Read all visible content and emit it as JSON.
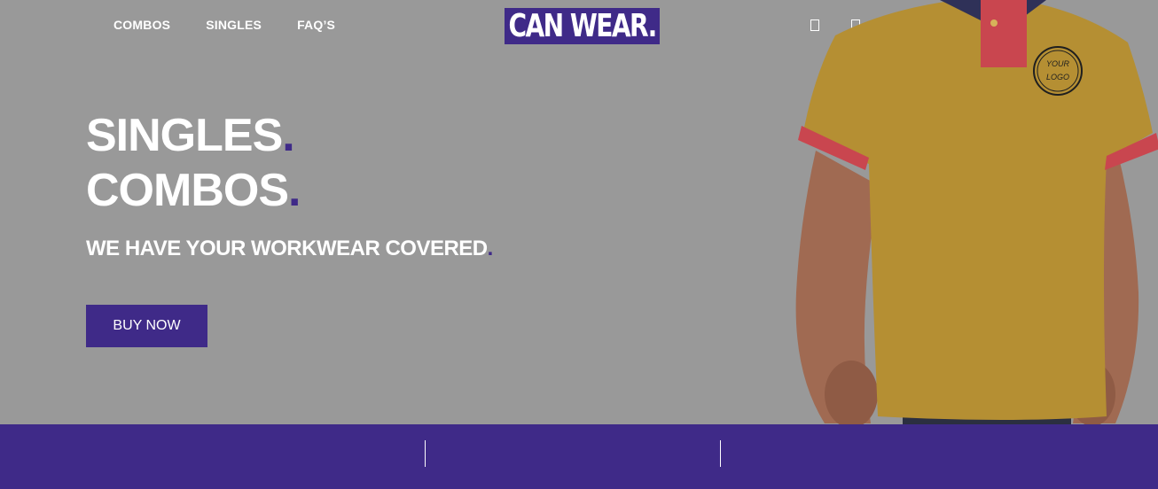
{
  "nav": {
    "items": [
      "COMBOS",
      "SINGLES",
      "FAQ’S"
    ]
  },
  "logo": {
    "text": "CAN WEAR."
  },
  "hero": {
    "line1": "SINGLES",
    "line2": "COMBOS",
    "dot": ".",
    "tagline": "WE HAVE YOUR WORKWEAR COVERED",
    "buy_label": "BUY NOW"
  },
  "shirt": {
    "logo_text_top": "YOUR",
    "logo_text_bottom": "LOGO"
  },
  "colors": {
    "brand": "#3f2a88",
    "background": "#999999",
    "shirt": "#b58f33",
    "accent": "#c9464f"
  },
  "icons": [
    "icon-1",
    "icon-2",
    "icon-3",
    "icon-4",
    "icon-5",
    "icon-6",
    "icon-7"
  ]
}
